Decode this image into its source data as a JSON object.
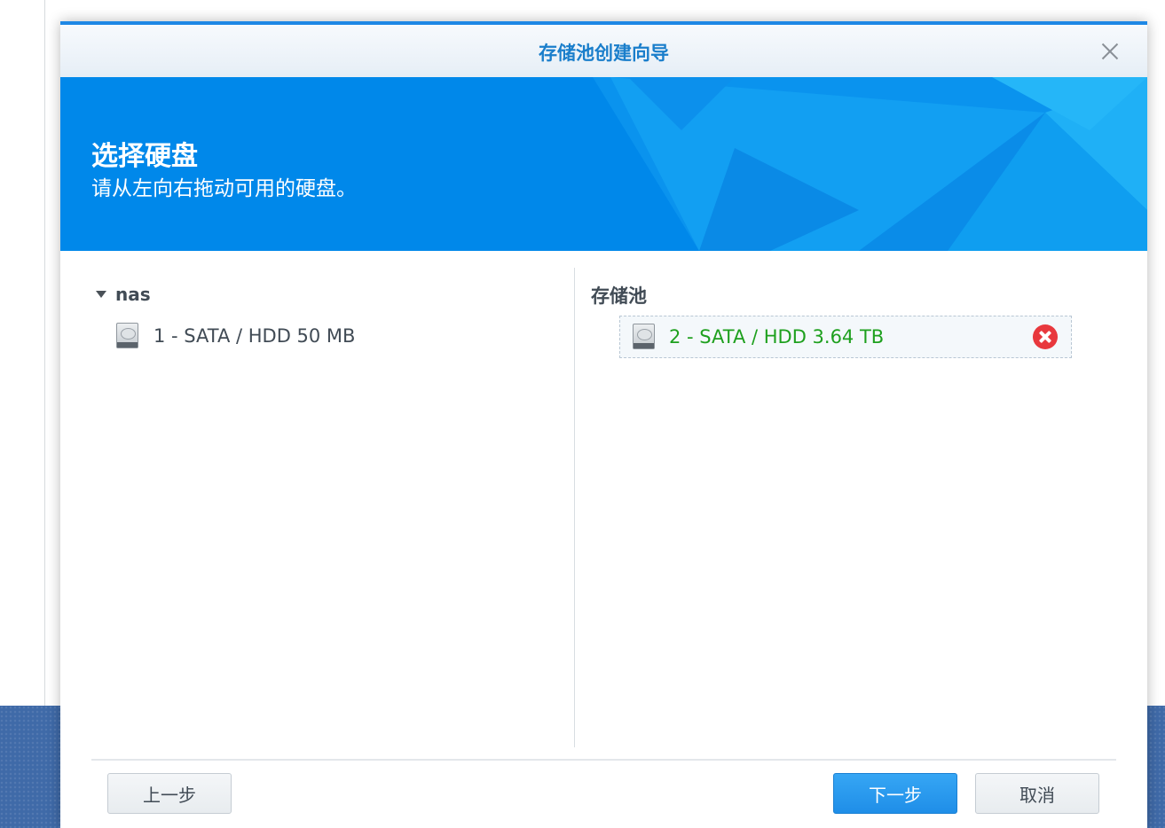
{
  "dialog": {
    "title": "存储池创建向导",
    "close_icon": "close-icon"
  },
  "banner": {
    "title": "选择硬盘",
    "subtitle": "请从左向右拖动可用的硬盘。"
  },
  "left_pane": {
    "node_label": "nas",
    "disks": [
      {
        "label": "1 - SATA / HDD 50 MB",
        "icon": "hdd-icon"
      }
    ]
  },
  "right_pane": {
    "title": "存储池",
    "disks": [
      {
        "label": "2 - SATA / HDD 3.64 TB",
        "icon": "hdd-icon",
        "label_color": "#1ea01e",
        "remove_icon": "remove-icon"
      }
    ]
  },
  "footer": {
    "back_label": "上一步",
    "next_label": "下一步",
    "cancel_label": "取消"
  },
  "colors": {
    "accent": "#1e88e5",
    "banner": "#0088ea",
    "title": "#1a7ecb",
    "remove": "#e8383d"
  }
}
